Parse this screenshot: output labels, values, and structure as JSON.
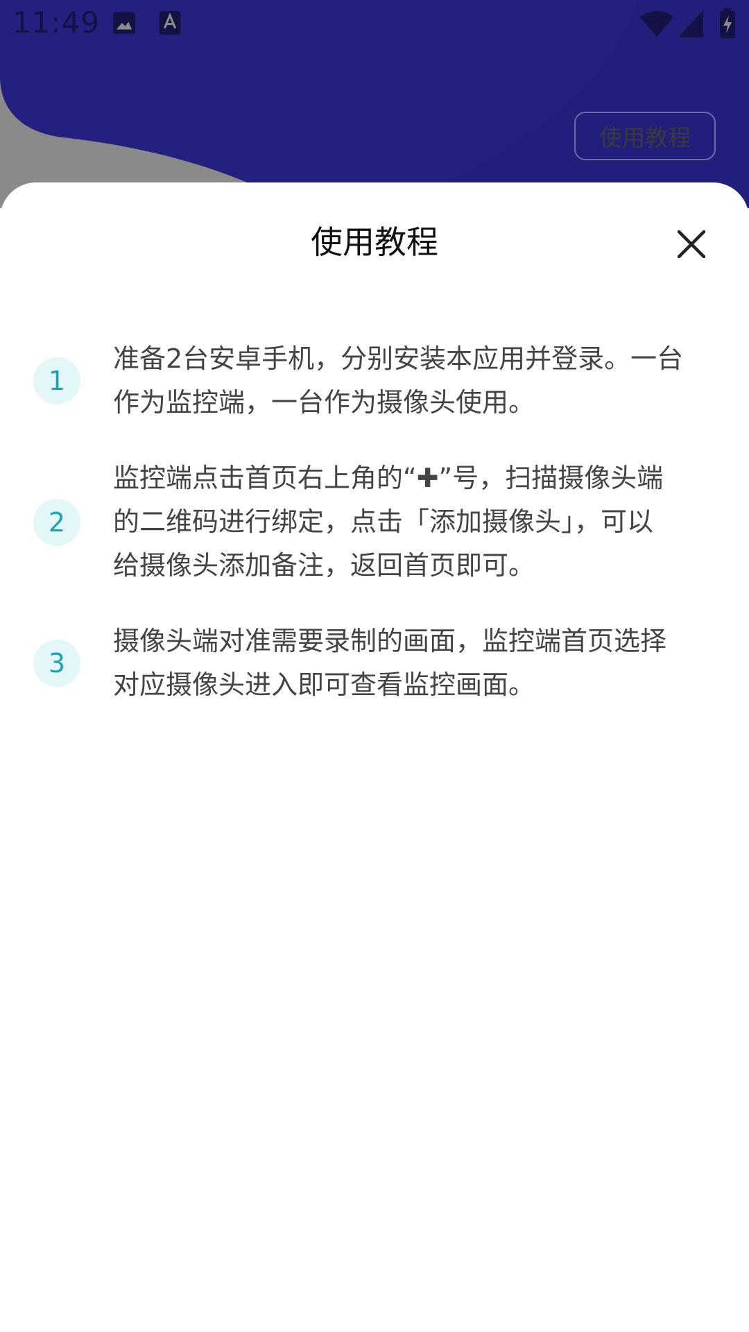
{
  "status_bar": {
    "time": "11:49",
    "icons": [
      "image-icon",
      "font-icon",
      "wifi-icon",
      "signal-icon",
      "battery-charging-icon"
    ]
  },
  "header": {
    "tutorial_button_label": "使用教程"
  },
  "sheet": {
    "title": "使用教程",
    "close_icon": "close-icon",
    "steps": [
      {
        "number": "1",
        "text": "准备2台安卓手机，分别安装本应用并登录。一台\n作为监控端，一台作为摄像头使用。"
      },
      {
        "number": "2",
        "text": "监控端点击首页右上角的“✚”号，扫描摄像头端\n的二维码进行绑定，点击「添加摄像头」，可以\n给摄像头添加备注，返回首页即可。"
      },
      {
        "number": "3",
        "text": "摄像头端对准需要录制的画面，监控端首页选择\n对应摄像头进入即可查看监控画面。"
      }
    ]
  },
  "colors": {
    "header_bg": "#232080",
    "dim_overlay": "#8a8a8a",
    "step_badge_bg": "#e3f6f8",
    "step_badge_text": "#1aa3b4",
    "body_text": "#444444"
  }
}
